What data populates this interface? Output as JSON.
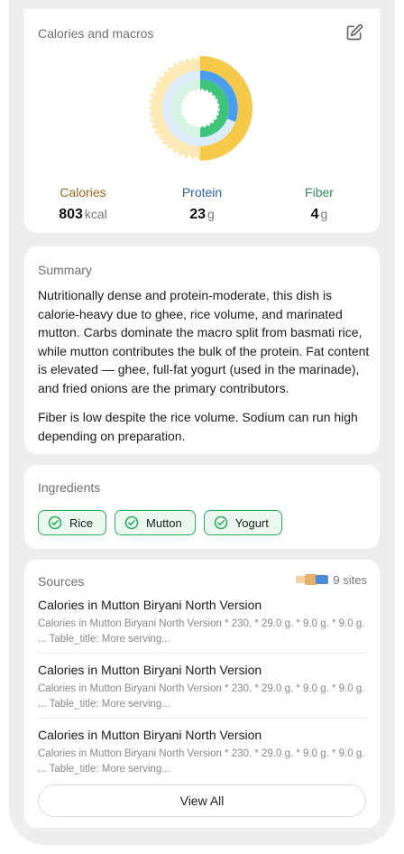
{
  "macros": {
    "title": "Calories and macros",
    "calories": {
      "label": "Calories",
      "value": "803",
      "unit": "kcal",
      "color": "#9a6a1c"
    },
    "protein": {
      "label": "Protein",
      "value": "23",
      "unit": "g",
      "color": "#2e62b8"
    },
    "fiber": {
      "label": "Fiber",
      "value": "4",
      "unit": "g",
      "color": "#3b8a55"
    }
  },
  "summary": {
    "title": "Summary",
    "p1": "Nutritionally dense and protein-moderate, this dish is calorie-heavy due to ghee, rice volume, and marinated mutton. Carbs dominate the macro split from basmati rice, while mutton contributes the bulk of the protein. Fat content is elevated — ghee, full-fat yogurt (used in the marinade), and fried onions are the primary contributors.",
    "p2": "Fiber is low despite the rice volume. Sodium can run high depending on preparation."
  },
  "ingredients": {
    "title": "Ingredients",
    "items": [
      "Rice",
      "Mutton",
      "Yogurt"
    ]
  },
  "sources": {
    "title": "Sources",
    "count": "9 sites",
    "items": [
      {
        "title": "Calories in Mutton Biryani North Version",
        "desc": "Calories in Mutton Biryani North Version * 230. * 29.0 g. * 9.0 g. * 9.0 g. ... Table_title: More serving..."
      },
      {
        "title": "Calories in Mutton Biryani North Version",
        "desc": "Calories in Mutton Biryani North Version * 230. * 29.0 g. * 9.0 g. * 9.0 g. ... Table_title: More serving..."
      },
      {
        "title": "Calories in Mutton Biryani North Version",
        "desc": "Calories in Mutton Biryani North Version * 230. * 29.0 g. * 9.0 g. * 9.0 g. ... Table_title: More serving..."
      }
    ],
    "view_all": "View All"
  },
  "icons": {
    "edit": "edit-icon",
    "check": "check-circle-icon"
  },
  "colors": {
    "accent_green": "#2fae62",
    "calorie_yellow": "#f7c948",
    "protein_blue": "#4a9df0",
    "fiber_green": "#3fc57a"
  }
}
